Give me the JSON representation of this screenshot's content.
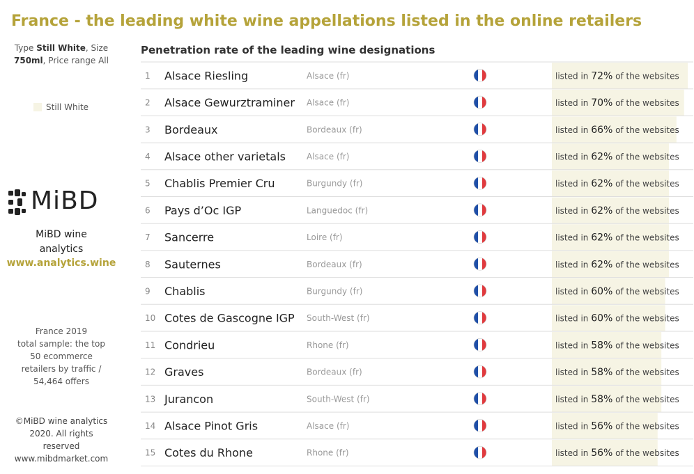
{
  "title": "France - the leading white wine appellations listed in the online retailers",
  "sidebar": {
    "filters_line1_prefix": "Type ",
    "filters_type": "Still White",
    "filters_line1_mid": ", Size",
    "filters_size": "750ml",
    "filters_line2_mid": ", Price range All",
    "legend_label": "Still White",
    "brand_line1": "MiBD wine",
    "brand_line2": "analytics",
    "brand_url": "www.analytics.wine",
    "logo_text": "MiBD",
    "sample_lines": [
      "France 2019",
      "total sample: the top",
      "50 ecommerce",
      "retailers by traffic  /",
      "54,464 offers"
    ],
    "copyright_lines": [
      "©MiBD wine analytics",
      "2020. All rights",
      "reserved",
      "www.mibdmarket.com"
    ]
  },
  "chart_data": {
    "type": "bar",
    "title": "Penetration rate of the leading wine designations",
    "label_prefix": "listed in ",
    "label_suffix": " of the websites",
    "xlim": [
      0,
      100
    ],
    "flag_icon": "france-flag-icon",
    "colors": {
      "bar": "#f6f4e4",
      "title": "#b5a33a",
      "divider": "#dddddd"
    },
    "rows": [
      {
        "rank": "1",
        "appellation": "Alsace Riesling",
        "region": "Alsace (fr)",
        "value": 72
      },
      {
        "rank": "2",
        "appellation": "Alsace Gewurztraminer",
        "region": "Alsace (fr)",
        "value": 70
      },
      {
        "rank": "3",
        "appellation": "Bordeaux",
        "region": "Bordeaux (fr)",
        "value": 66
      },
      {
        "rank": "4",
        "appellation": "Alsace other varietals",
        "region": "Alsace (fr)",
        "value": 62
      },
      {
        "rank": "5",
        "appellation": "Chablis Premier Cru",
        "region": "Burgundy (fr)",
        "value": 62
      },
      {
        "rank": "6",
        "appellation": "Pays d’Oc IGP",
        "region": "Languedoc (fr)",
        "value": 62
      },
      {
        "rank": "7",
        "appellation": "Sancerre",
        "region": "Loire (fr)",
        "value": 62
      },
      {
        "rank": "8",
        "appellation": "Sauternes",
        "region": "Bordeaux (fr)",
        "value": 62
      },
      {
        "rank": "9",
        "appellation": "Chablis",
        "region": "Burgundy (fr)",
        "value": 60
      },
      {
        "rank": "10",
        "appellation": "Cotes de Gascogne IGP",
        "region": "South-West (fr)",
        "value": 60
      },
      {
        "rank": "11",
        "appellation": "Condrieu",
        "region": "Rhone (fr)",
        "value": 58
      },
      {
        "rank": "12",
        "appellation": "Graves",
        "region": "Bordeaux (fr)",
        "value": 58
      },
      {
        "rank": "13",
        "appellation": "Jurancon",
        "region": "South-West (fr)",
        "value": 58
      },
      {
        "rank": "14",
        "appellation": "Alsace Pinot Gris",
        "region": "Alsace (fr)",
        "value": 56
      },
      {
        "rank": "15",
        "appellation": "Cotes du Rhone",
        "region": "Rhone (fr)",
        "value": 56
      }
    ]
  }
}
